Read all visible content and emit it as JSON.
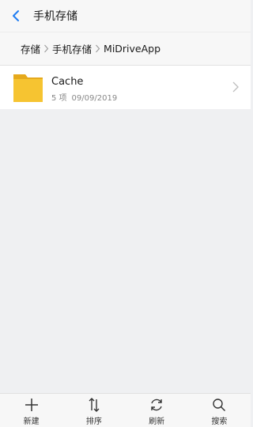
{
  "header": {
    "title": "手机存储",
    "accent_color": "#1e7cf2"
  },
  "breadcrumb": {
    "items": [
      "存储",
      "手机存储",
      "MiDriveApp"
    ]
  },
  "files": [
    {
      "name": "Cache",
      "count": "5 项",
      "date": "09/09/2019",
      "icon": "folder-icon",
      "icon_color": "#f6c431"
    }
  ],
  "toolbar": {
    "items": [
      {
        "label": "新建",
        "icon": "plus-icon"
      },
      {
        "label": "排序",
        "icon": "sort-icon"
      },
      {
        "label": "刷新",
        "icon": "refresh-icon"
      },
      {
        "label": "搜索",
        "icon": "search-icon"
      }
    ]
  }
}
